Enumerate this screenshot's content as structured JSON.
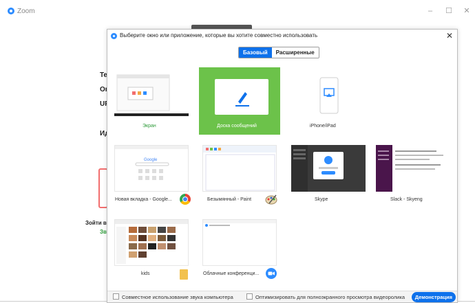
{
  "app": {
    "title": "Zoom",
    "minimize_glyph": "–",
    "maximize_glyph": "☐",
    "close_glyph": "✕"
  },
  "background": {
    "label_te": "Te",
    "label_or": "Or",
    "label_ur": "UR",
    "label_id": "Ид",
    "label_join": "Зойти в",
    "label_zvu": "Зву"
  },
  "dialog": {
    "title": "Выберите окно или приложение, которые вы хотите совместно использовать",
    "close_glyph": "✕",
    "tabs": [
      {
        "label": "Базовый",
        "active": true
      },
      {
        "label": "Расширенные",
        "active": false
      }
    ],
    "tiles": [
      {
        "label": "Экран",
        "selected": false,
        "label_color": "#2e9b3a"
      },
      {
        "label": "Доска сообщений",
        "selected": true,
        "label_color": "#ffffff"
      },
      {
        "label": "iPhone/iPad",
        "selected": false,
        "label_color": "#333333"
      },
      {
        "label": "",
        "selected": false,
        "label_color": "#333333"
      },
      {
        "label": "Новая вкладка - Google...",
        "selected": false,
        "label_color": "#333333"
      },
      {
        "label": "Безымянный - Paint",
        "selected": false,
        "label_color": "#333333"
      },
      {
        "label": "Skype",
        "selected": false,
        "label_color": "#333333"
      },
      {
        "label": "Slack - Skyeng",
        "selected": false,
        "label_color": "#333333"
      },
      {
        "label": "kids",
        "selected": false,
        "label_color": "#333333"
      },
      {
        "label": "Облачные конференци...",
        "selected": false,
        "label_color": "#333333"
      }
    ],
    "footer": {
      "share_audio_label": "Совместное использование звука компьютера",
      "optimize_video_label": "Оптимизировать для полноэкранного просмотра видеоролика",
      "share_button_label": "Демонстрация"
    }
  },
  "colors": {
    "accent": "#0e71eb",
    "selected_tile": "#6cc24a",
    "zoom_blue": "#2d8cff"
  }
}
